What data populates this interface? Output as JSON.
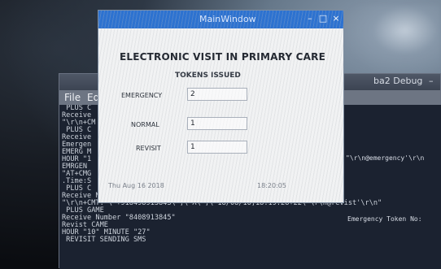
{
  "background_window": {
    "title": "ba2 Debug",
    "menu": [
      "File",
      "Ed"
    ],
    "terminal_lines": [
      " PLUS C",
      "Receive",
      "\"\\r\\n+CM",
      " PLUS C",
      "Receive",
      "Emergen",
      "EMERG M",
      "HOUR \"1",
      "EMRGEN",
      "\"AT+CMG",
      ".Time:S",
      " PLUS C",
      "Receive Number \"8913845\"\\r\\r\"",
      "\"\\r\\n+CMT: \\\"+91849891384S\\\",\\\"A\\\",\\\"18/08/16,18:19:28+22\\\"\\r\\n@revist'\\r\\n\"",
      " PLUS GAME",
      "Receive Number \"8408913845\"",
      "Revist CAME",
      "HOUR \"10\" MINUTE \"27\"",
      " REVISIT SENDING SMS"
    ],
    "right_notes": [
      "\"\\r\\n@emergency'\\r\\n",
      "Emergency Token No:"
    ]
  },
  "front_window": {
    "title": "MainWindow",
    "controls": {
      "minimize": "–",
      "maximize": "□",
      "close": "×"
    },
    "heading": "ELECTRONIC VISIT IN PRIMARY CARE",
    "subheading": "TOKENS ISSUED",
    "fields": [
      {
        "label": "EMERGENCY",
        "value": "2"
      },
      {
        "label": "NORMAL",
        "value": "1"
      },
      {
        "label": "REVISIT",
        "value": "1"
      }
    ],
    "footer": {
      "date": "Thu Aug 16 2018",
      "time": "18:20:05"
    }
  }
}
